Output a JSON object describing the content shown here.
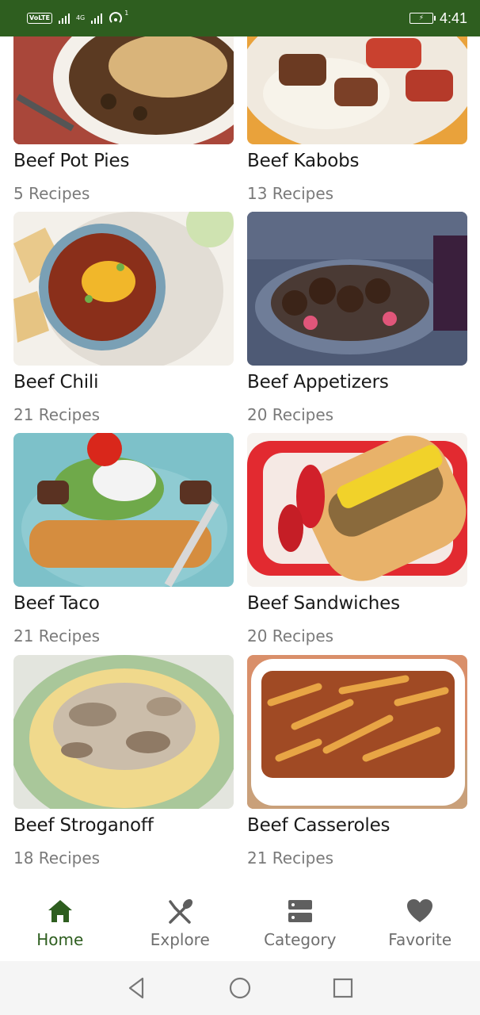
{
  "status_bar": {
    "network_badge": "VoLTE",
    "network_type": "4G",
    "notification_count": "1",
    "time": "4:41"
  },
  "categories": [
    {
      "title": "Beef Pot Pies",
      "count": "5 Recipes"
    },
    {
      "title": "Beef Kabobs",
      "count": "13 Recipes"
    },
    {
      "title": "Beef Chili",
      "count": "21 Recipes"
    },
    {
      "title": "Beef Appetizers",
      "count": "20 Recipes"
    },
    {
      "title": "Beef Taco",
      "count": "21 Recipes"
    },
    {
      "title": "Beef Sandwiches",
      "count": "20 Recipes"
    },
    {
      "title": "Beef Stroganoff",
      "count": "18 Recipes"
    },
    {
      "title": "Beef Casseroles",
      "count": "21 Recipes"
    }
  ],
  "bottom_nav": {
    "items": [
      {
        "label": "Home",
        "icon": "home-icon",
        "active": true
      },
      {
        "label": "Explore",
        "icon": "utensils-icon",
        "active": false
      },
      {
        "label": "Category",
        "icon": "category-icon",
        "active": false
      },
      {
        "label": "Favorite",
        "icon": "heart-icon",
        "active": false
      }
    ],
    "active_color": "#2e5e1f",
    "inactive_color": "#6f6f6f"
  },
  "colors": {
    "status_bar": "#2e5e1f"
  }
}
